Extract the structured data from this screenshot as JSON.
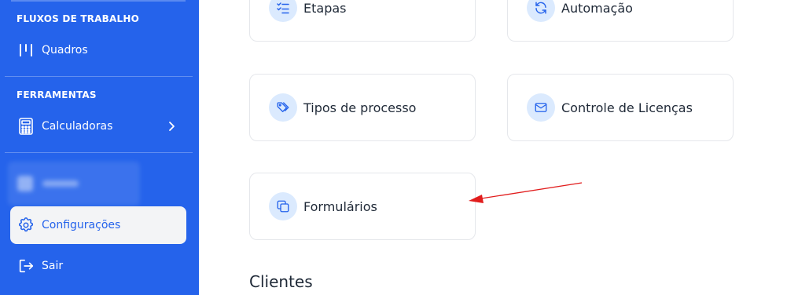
{
  "sidebar": {
    "sections": {
      "workflows": "FLUXOS DE TRABALHO",
      "tools": "FERRAMENTAS"
    },
    "items": {
      "boards": "Quadros",
      "calculators": "Calculadoras",
      "settings": "Configurações",
      "logout": "Sair"
    }
  },
  "main": {
    "cards": {
      "stages": "Etapas",
      "automation": "Automação",
      "process_types": "Tipos de processo",
      "license_control": "Controle de Licenças",
      "forms": "Formulários"
    },
    "section_heading": "Clientes"
  },
  "colors": {
    "sidebar_bg": "#2563eb",
    "active_bg": "#f3f4f6",
    "icon_circle": "#dbeafe",
    "annotation_arrow": "#e11d1d"
  }
}
